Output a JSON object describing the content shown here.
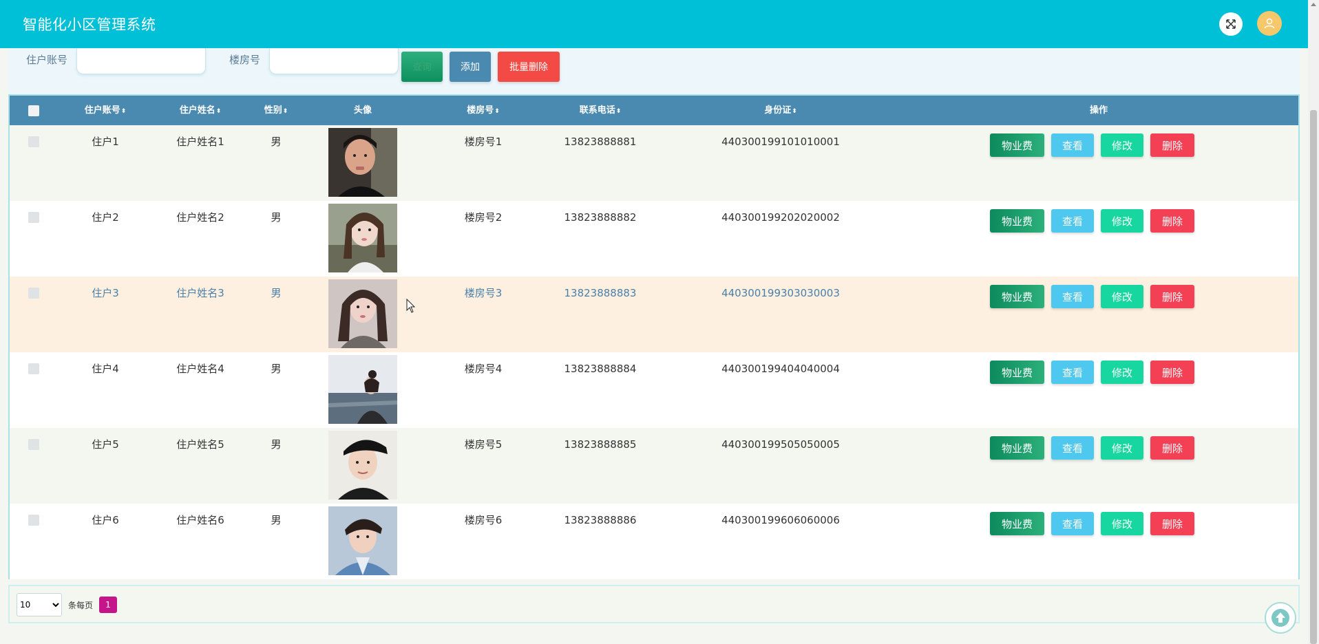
{
  "app": {
    "title": "智能化小区管理系统"
  },
  "search": {
    "account_label": "住户账号",
    "account_value": "",
    "building_label": "楼房号",
    "building_value": "",
    "search_button": "查询",
    "add_button": "添加",
    "batch_delete_button": "批量删除"
  },
  "table": {
    "headers": {
      "account": "住户账号",
      "name": "住户姓名",
      "gender": "性别",
      "avatar": "头像",
      "building": "楼房号",
      "phone": "联系电话",
      "idcard": "身份证",
      "actions": "操作"
    },
    "sort_glyph": "⬍",
    "action_labels": {
      "fee": "物业费",
      "view": "查看",
      "edit": "修改",
      "delete": "删除"
    },
    "rows": [
      {
        "account": "住户1",
        "name": "住户姓名1",
        "gender": "男",
        "building": "楼房号1",
        "phone": "13823888881",
        "idcard": "440300199101010001"
      },
      {
        "account": "住户2",
        "name": "住户姓名2",
        "gender": "男",
        "building": "楼房号2",
        "phone": "13823888882",
        "idcard": "440300199202020002"
      },
      {
        "account": "住户3",
        "name": "住户姓名3",
        "gender": "男",
        "building": "楼房号3",
        "phone": "13823888883",
        "idcard": "440300199303030003"
      },
      {
        "account": "住户4",
        "name": "住户姓名4",
        "gender": "男",
        "building": "楼房号4",
        "phone": "13823888884",
        "idcard": "440300199404040004"
      },
      {
        "account": "住户5",
        "name": "住户姓名5",
        "gender": "男",
        "building": "楼房号5",
        "phone": "13823888885",
        "idcard": "440300199505050005"
      },
      {
        "account": "住户6",
        "name": "住户姓名6",
        "gender": "男",
        "building": "楼房号6",
        "phone": "13823888886",
        "idcard": "440300199606060006"
      }
    ]
  },
  "pager": {
    "page_size": "10",
    "per_page_label": "条每页",
    "current_page": "1"
  },
  "colors": {
    "topbar": "#00c0d8",
    "table_header": "#4a8ab0",
    "hover_row": "#fdf0e0",
    "striped_row": "#f3f7f0",
    "current_page": "#c4168a"
  }
}
